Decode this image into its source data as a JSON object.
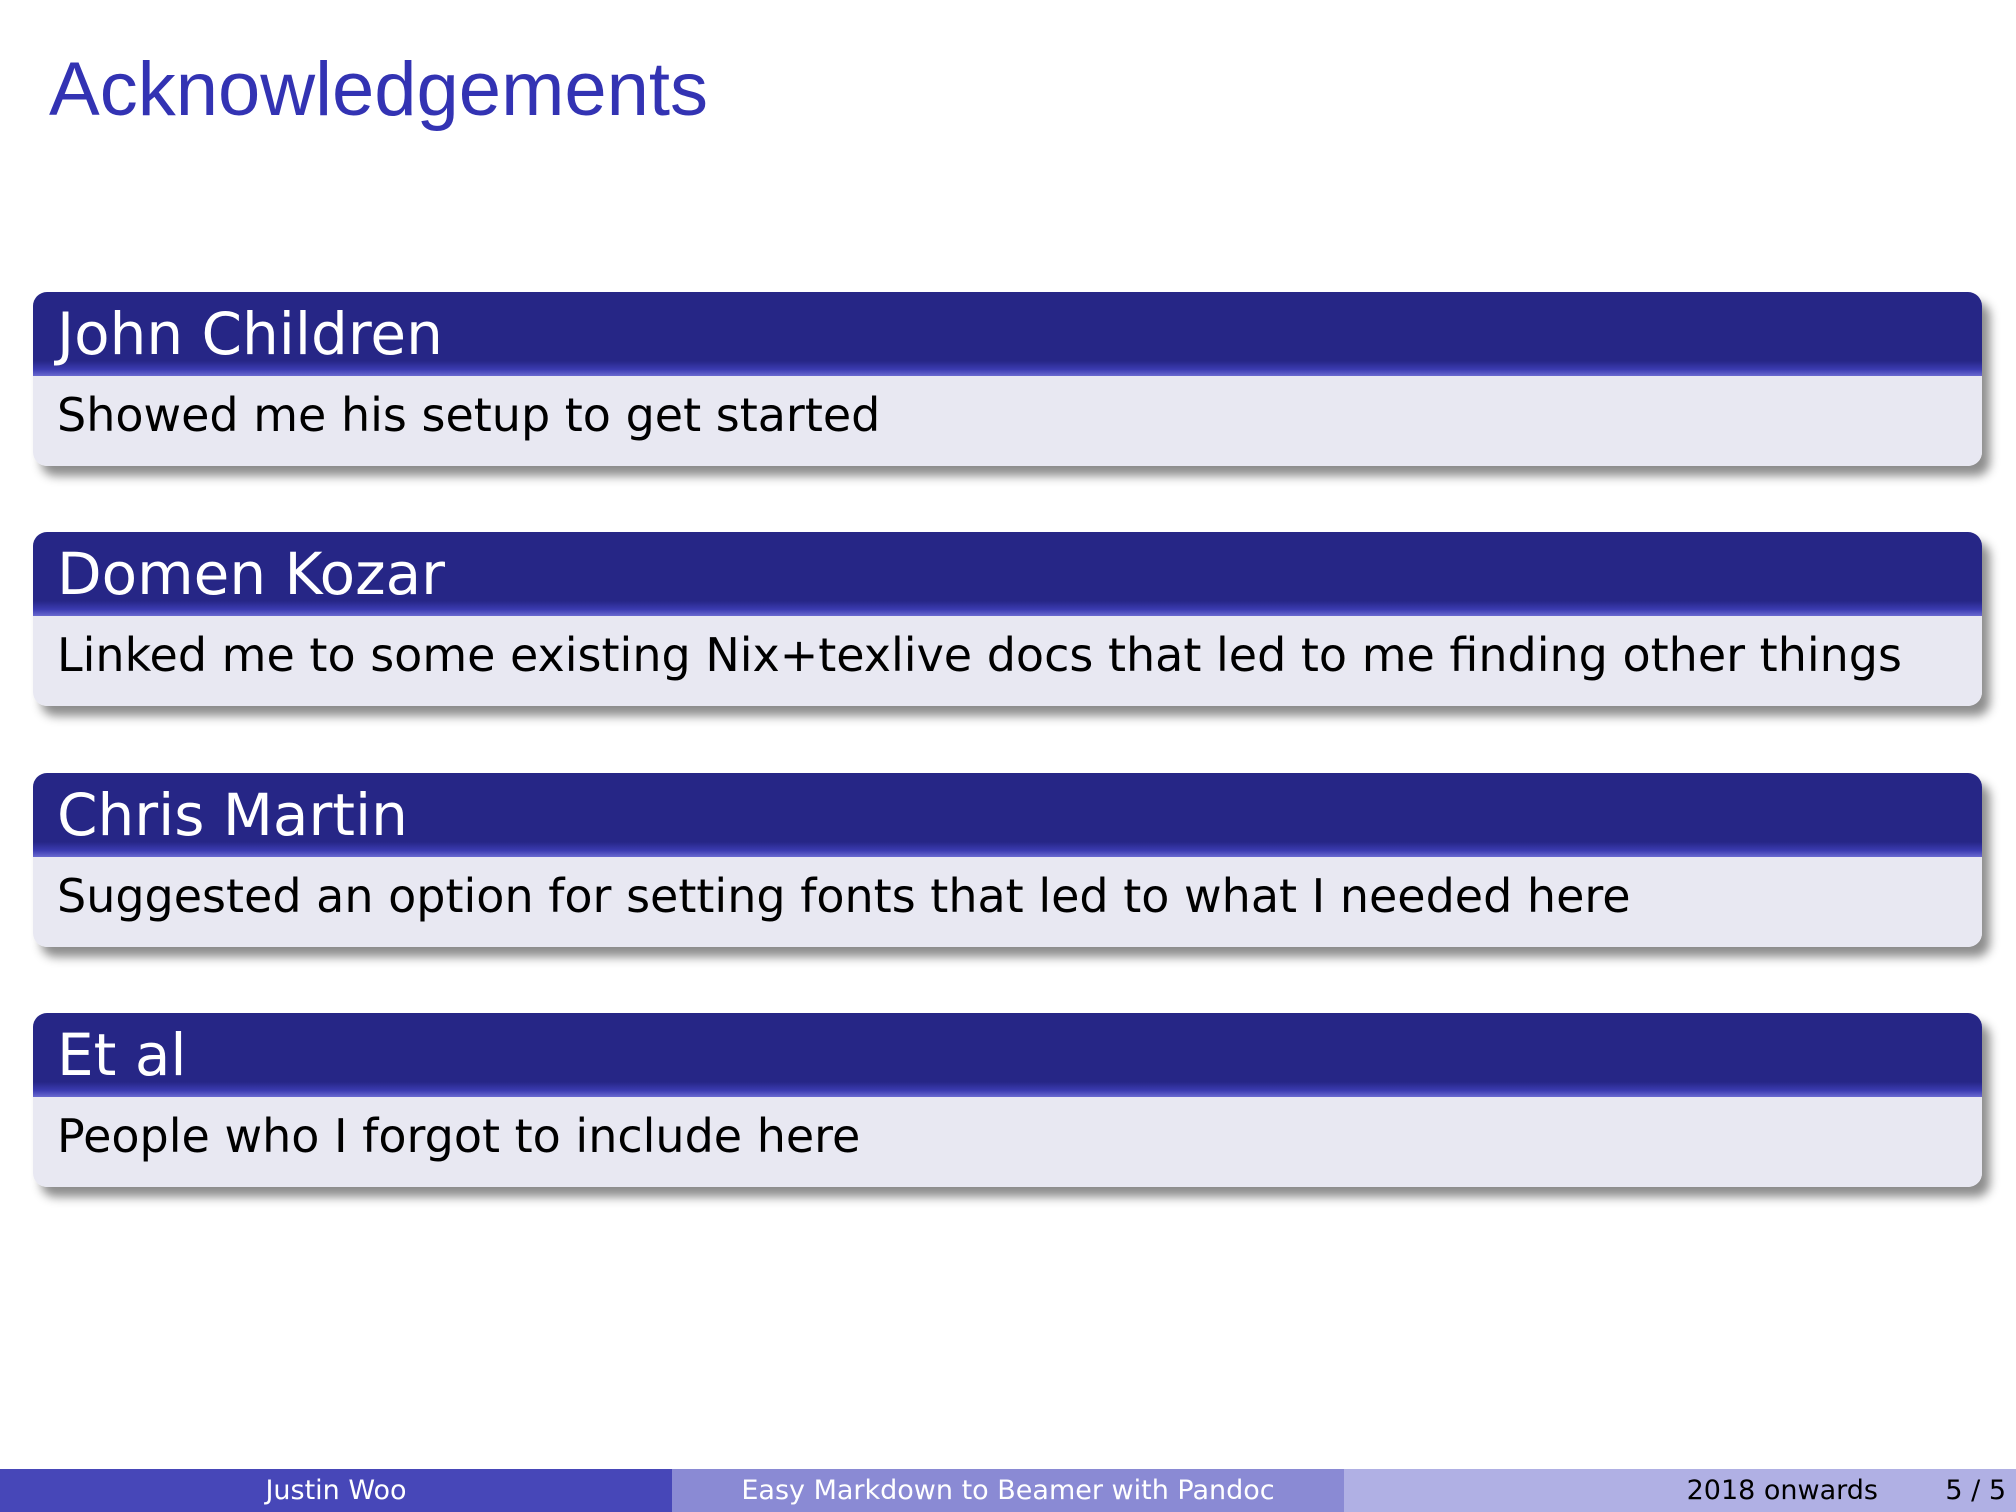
{
  "slide": {
    "title": "Acknowledgements",
    "blocks": [
      {
        "title": "John Children",
        "body": "Showed me his setup to get started"
      },
      {
        "title": "Domen Kozar",
        "body": "Linked me to some existing Nix+texlive docs that led to me finding other things"
      },
      {
        "title": "Chris Martin",
        "body": "Suggested an option for setting fonts that led to what I needed here"
      },
      {
        "title": "Et al",
        "body": "People who I forgot to include here"
      }
    ]
  },
  "footer": {
    "author": "Justin Woo",
    "title": "Easy Markdown to Beamer with Pandoc",
    "date": "2018 onwards",
    "page": "5 / 5"
  },
  "colors": {
    "frame_title": "#3333b3",
    "block_title_bg": "#262686",
    "block_body_bg": "#e8e8f2",
    "footer_author_bg": "#4747b8",
    "footer_title_bg": "#8a8ad4",
    "footer_date_bg": "#b0b0e4"
  }
}
